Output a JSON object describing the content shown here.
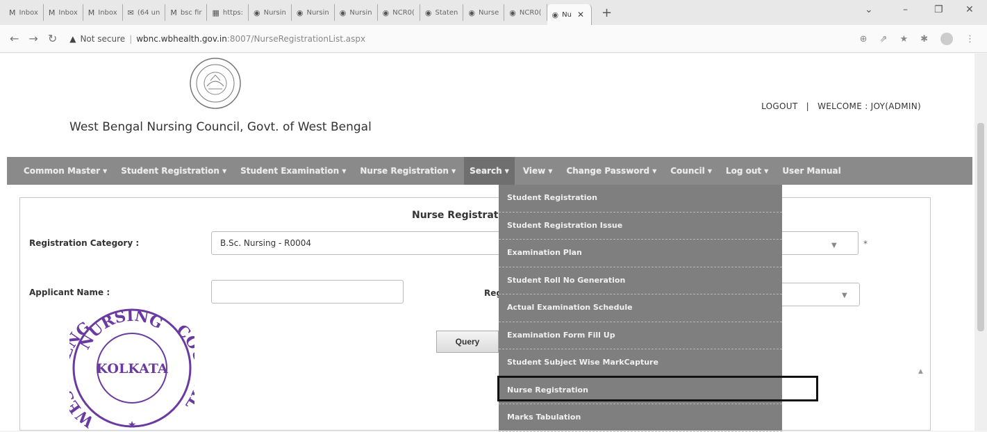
{
  "browser": {
    "tabs": [
      {
        "icon": "M",
        "label": "Inbox"
      },
      {
        "icon": "M",
        "label": "Inbox"
      },
      {
        "icon": "M",
        "label": "Inbox"
      },
      {
        "icon": "✉",
        "label": "(64 un"
      },
      {
        "icon": "M",
        "label": "bsc fir"
      },
      {
        "icon": "▦",
        "label": "https:"
      },
      {
        "icon": "◉",
        "label": "Nursin"
      },
      {
        "icon": "◉",
        "label": "Nursin"
      },
      {
        "icon": "◉",
        "label": "Nursin"
      },
      {
        "icon": "◉",
        "label": "NCR0("
      },
      {
        "icon": "◉",
        "label": "Staten"
      },
      {
        "icon": "◉",
        "label": "Nurse"
      },
      {
        "icon": "◉",
        "label": "NCR0("
      }
    ],
    "active_tab": {
      "icon": "◉",
      "label": "Nu",
      "close": "✕"
    },
    "new_tab": "+",
    "address": {
      "warning": "Not secure",
      "host": "wbnc.wbhealth.gov.in",
      "path": ":8007/NurseRegistrationList.aspx"
    }
  },
  "header": {
    "org_name": "West Bengal Nursing Council, Govt. of West Bengal",
    "logout": "LOGOUT",
    "welcome": "WELCOME : JOY(ADMIN)"
  },
  "menu": {
    "items": [
      "Common Master ▾",
      "Student Registration ▾",
      "Student Examination ▾",
      "Nurse Registration ▾",
      "Search ▾",
      "View ▾",
      "Change Password ▾",
      "Council ▾",
      "Log out ▾",
      "User Manual"
    ]
  },
  "dropdown": {
    "items": [
      "Student Registration",
      "Student Registration Issue",
      "Examination Plan",
      "Student Roll No Generation",
      "Actual Examination Schedule",
      "Examination Form Fill Up",
      "Student Subject Wise MarkCapture",
      "Nurse Registration",
      "Marks Tabulation"
    ]
  },
  "form": {
    "title": "Nurse Registrat",
    "reg_category_label": "Registration Category :",
    "reg_category_value": "B.Sc. Nursing - R0004",
    "applicant_label": "Applicant Name :",
    "applicant_value": "",
    "reg_partial_label": "Reg",
    "required_mark": "*",
    "query_button": "Query"
  },
  "stamp": {
    "top_text": "NURSING",
    "left_text": "WEST BENGAL",
    "right_text": "COUNCIL",
    "center_text": "KOLKATA"
  }
}
